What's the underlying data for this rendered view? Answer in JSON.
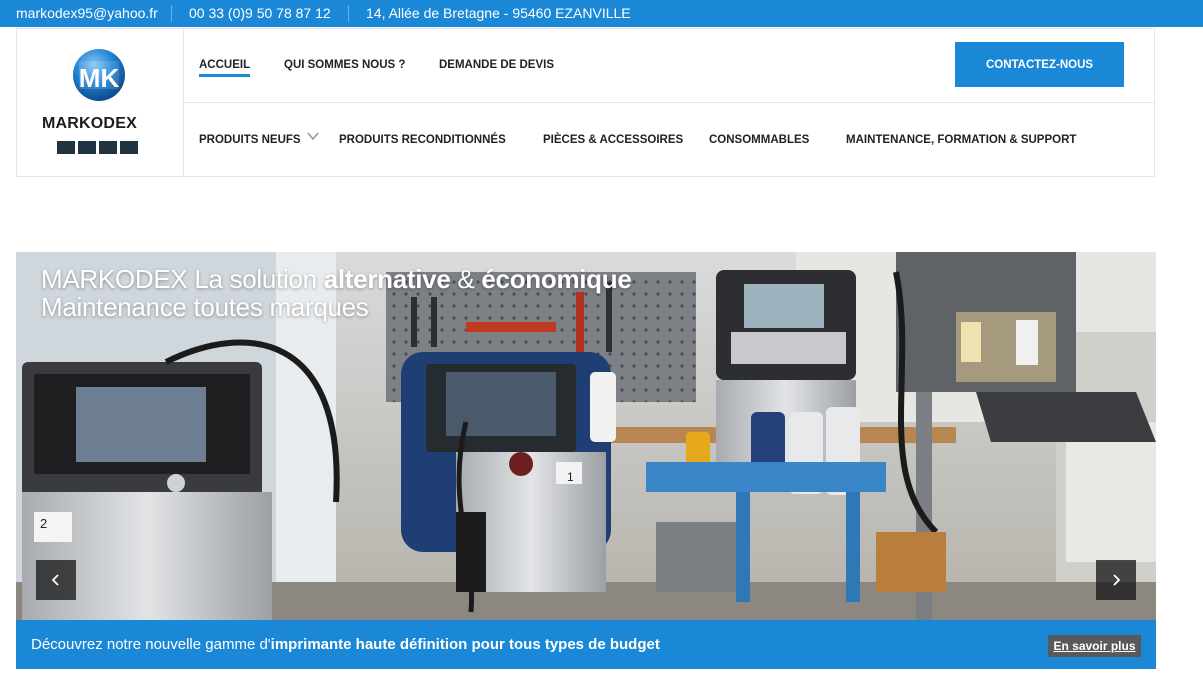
{
  "topbar": {
    "email": "markodex95@yahoo.fr",
    "phone": "00 33 (0)9 50 78 87 12",
    "address": "14, Allée de Bretagne - 95460 EZANVILLE"
  },
  "logo": {
    "name": "MARKODEX",
    "monogram": "MK"
  },
  "nav_top": {
    "items": [
      "ACCUEIL",
      "QUI SOMMES NOUS ?",
      "DEMANDE DE DEVIS"
    ],
    "active": "ACCUEIL",
    "cta_label": "CONTACTEZ-NOUS"
  },
  "nav_main": {
    "items": [
      "PRODUITS NEUFS",
      "PRODUITS RECONDITIONNÉS",
      "PIÈCES & ACCESSOIRES",
      "CONSOMMABLES",
      "MAINTENANCE, FORMATION & SUPPORT"
    ]
  },
  "slider": {
    "line1_a": "MARKODEX La solution ",
    "line1_b": "alternative",
    "line1_c": " & ",
    "line1_d": "économique",
    "line2": "Maintenance toutes marques",
    "photo_labels": [
      "2",
      "1"
    ]
  },
  "caption": {
    "text_a": "Découvrez notre nouvelle gamme d'",
    "text_b": "imprimante haute définition pour tous types de budget",
    "button": "En savoir plus"
  },
  "colors": {
    "accent": "#1a88d6",
    "dark_button": "#58595b"
  }
}
